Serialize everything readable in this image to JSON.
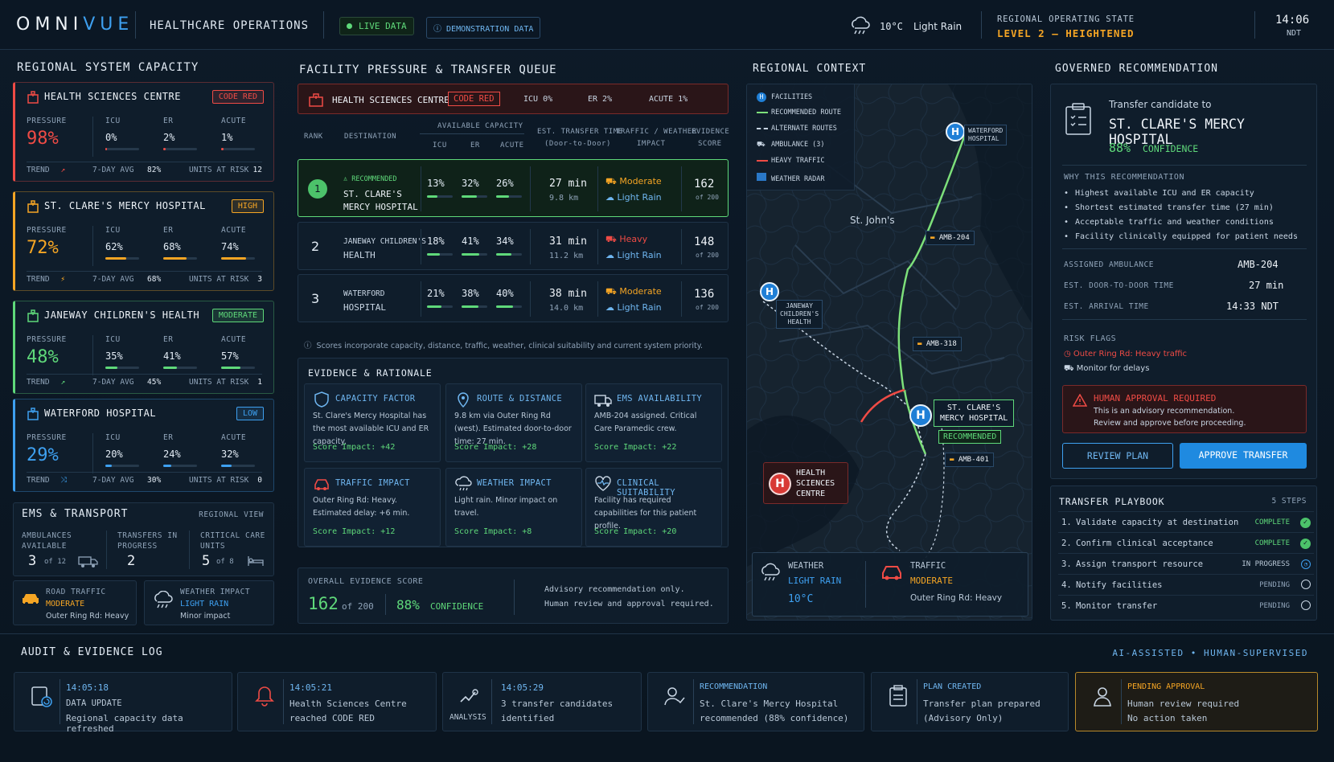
{
  "header": {
    "brand_a": "OMNI",
    "brand_b": "VUE",
    "section": "HEALTHCARE OPERATIONS",
    "live": "LIVE DATA",
    "demo": "DEMONSTRATION DATA",
    "temp": "10°C",
    "weather": "Light Rain",
    "state_label": "REGIONAL OPERATING STATE",
    "state_value": "LEVEL 2 – HEIGHTENED",
    "time": "14:06",
    "tz": "NDT"
  },
  "capacity": {
    "title": "REGIONAL SYSTEM CAPACITY",
    "labels": {
      "pressure": "PRESSURE",
      "icu": "ICU",
      "er": "ER",
      "acute": "ACUTE",
      "trend": "TREND",
      "avg": "7-DAY AVG",
      "units": "UNITS AT RISK"
    },
    "cards": [
      {
        "name": "HEALTH SCIENCES CENTRE",
        "badge": "CODE RED",
        "pressure": "98%",
        "icu": "0%",
        "er": "2%",
        "acute": "1%",
        "icu_v": 0.04,
        "er_v": 0.08,
        "acute_v": 0.06,
        "avg": "82%",
        "units": "12",
        "color": "#ef4b45"
      },
      {
        "name": "ST. CLARE'S MERCY HOSPITAL",
        "badge": "HIGH",
        "pressure": "72%",
        "icu": "62%",
        "er": "68%",
        "acute": "74%",
        "icu_v": 0.62,
        "er_v": 0.68,
        "acute_v": 0.74,
        "avg": "68%",
        "units": "3",
        "color": "#f5a524"
      },
      {
        "name": "JANEWAY CHILDREN'S HEALTH",
        "badge": "MODERATE",
        "pressure": "48%",
        "icu": "35%",
        "er": "41%",
        "acute": "57%",
        "icu_v": 0.35,
        "er_v": 0.41,
        "acute_v": 0.57,
        "avg": "45%",
        "units": "1",
        "color": "#5fd97a"
      },
      {
        "name": "WATERFORD HOSPITAL",
        "badge": "LOW",
        "pressure": "29%",
        "icu": "20%",
        "er": "24%",
        "acute": "32%",
        "icu_v": 0.2,
        "er_v": 0.24,
        "acute_v": 0.32,
        "avg": "30%",
        "units": "0",
        "color": "#3ea0f0"
      }
    ]
  },
  "ems": {
    "title": "EMS & TRANSPORT",
    "view": "REGIONAL VIEW",
    "amb_label": "AMBULANCES AVAILABLE",
    "amb": "3",
    "amb_of": "of 12",
    "trans_label": "TRANSFERS IN PROGRESS",
    "trans": "2",
    "crit_label": "CRITICAL CARE UNITS",
    "crit": "5",
    "crit_of": "of 8",
    "road_label": "ROAD TRAFFIC",
    "road_val": "MODERATE",
    "road_sub": "Outer Ring Rd: Heavy",
    "wx_label": "WEATHER IMPACT",
    "wx_val": "LIGHT RAIN",
    "wx_sub": "Minor impact"
  },
  "queue": {
    "title": "FACILITY PRESSURE & TRANSFER QUEUE",
    "src_name": "HEALTH SCIENCES CENTRE",
    "src_badge": "CODE RED",
    "src_icu": "ICU 0%",
    "src_er": "ER 2%",
    "src_acute": "ACUTE 1%",
    "cols": {
      "rank": "RANK",
      "dest": "DESTINATION",
      "avail": "AVAILABLE CAPACITY",
      "icu": "ICU",
      "er": "ER",
      "acute": "ACUTE",
      "time": "EST. TRANSFER TIME",
      "time2": "(Door-to-Door)",
      "tw": "TRAFFIC / WEATHER",
      "tw2": "IMPACT",
      "ev": "EVIDENCE",
      "ev2": "SCORE"
    },
    "rows": [
      {
        "rank": "1",
        "tag": "RECOMMENDED",
        "dest1": "ST. CLARE'S",
        "dest2": "MERCY HOSPITAL",
        "icu": "13%",
        "er": "32%",
        "acute": "26%",
        "icu_v": 0.4,
        "er_v": 0.6,
        "acute_v": 0.5,
        "time": "27 min",
        "dist": "9.8 km",
        "traffic": "Moderate",
        "wx": "Light Rain",
        "score": "162",
        "of": "of 200"
      },
      {
        "rank": "2",
        "tag": "",
        "dest1": "JANEWAY CHILDREN'S",
        "dest2": "HEALTH",
        "icu": "18%",
        "er": "41%",
        "acute": "34%",
        "icu_v": 0.5,
        "er_v": 0.7,
        "acute_v": 0.6,
        "time": "31 min",
        "dist": "11.2 km",
        "traffic": "Heavy",
        "wx": "Light Rain",
        "score": "148",
        "of": "of 200"
      },
      {
        "rank": "3",
        "tag": "",
        "dest1": "WATERFORD",
        "dest2": "HOSPITAL",
        "icu": "21%",
        "er": "38%",
        "acute": "40%",
        "icu_v": 0.55,
        "er_v": 0.65,
        "acute_v": 0.65,
        "time": "38 min",
        "dist": "14.0 km",
        "traffic": "Moderate",
        "wx": "Light Rain",
        "score": "136",
        "of": "of 200"
      }
    ],
    "note": "Scores incorporate capacity, distance, traffic, weather, clinical suitability and current system priority."
  },
  "evidence": {
    "title": "EVIDENCE & RATIONALE",
    "items": [
      {
        "t": "CAPACITY FACTOR",
        "d": "St. Clare's Mercy Hospital has the most available ICU and ER capacity.",
        "s": "Score Impact: +42"
      },
      {
        "t": "ROUTE & DISTANCE",
        "d": "9.8 km via Outer Ring Rd (west). Estimated door-to-door time: 27 min.",
        "s": "Score Impact: +28"
      },
      {
        "t": "EMS AVAILABILITY",
        "d": "AMB-204 assigned. Critical Care Paramedic crew.",
        "s": "Score Impact: +22"
      },
      {
        "t": "TRAFFIC IMPACT",
        "d": "Outer Ring Rd: Heavy. Estimated delay: +6 min.",
        "s": "Score Impact: +12"
      },
      {
        "t": "WEATHER IMPACT",
        "d": "Light rain. Minor impact on travel.",
        "s": "Score Impact: +8"
      },
      {
        "t": "CLINICAL SUITABILITY",
        "d": "Facility has required capabilities for this patient profile.",
        "s": "Score Impact: +20"
      }
    ],
    "overall_label": "OVERALL EVIDENCE SCORE",
    "overall": "162",
    "overall_of": "of 200",
    "conf": "88%",
    "conf_label": "CONFIDENCE",
    "adv1": "Advisory recommendation only.",
    "adv2": "Human review and approval required."
  },
  "map": {
    "title": "REGIONAL CONTEXT",
    "legend": [
      "FACILITIES",
      "RECOMMENDED ROUTE",
      "ALTERNATE ROUTES",
      "AMBULANCE (3)",
      "HEAVY TRAFFIC",
      "WEATHER RADAR"
    ],
    "city": "St. John's",
    "waterford": [
      "WATERFORD",
      "HOSPITAL"
    ],
    "janeway": [
      "JANEWAY",
      "CHILDREN'S",
      "HEALTH"
    ],
    "stclare": [
      "ST. CLARE'S",
      "MERCY HOSPITAL"
    ],
    "recommended": "RECOMMENDED",
    "hsc": [
      "HEALTH",
      "SCIENCES",
      "CENTRE"
    ],
    "amb1": "AMB-204",
    "amb2": "AMB-318",
    "amb3": "AMB-401",
    "h": "H",
    "wx_label": "WEATHER",
    "wx_val": "LIGHT RAIN",
    "wx_temp": "10°C",
    "tr_label": "TRAFFIC",
    "tr_val": "MODERATE",
    "tr_sub": "Outer Ring Rd: Heavy"
  },
  "rec": {
    "title": "GOVERNED RECOMMENDATION",
    "cand": "Transfer candidate to",
    "hosp": "ST. CLARE'S MERCY HOSPITAL",
    "conf": "88%",
    "conf_label": "CONFIDENCE",
    "why": "WHY THIS RECOMMENDATION",
    "reasons": [
      "Highest available ICU and ER capacity",
      "Shortest estimated transfer time (27 min)",
      "Acceptable traffic and weather conditions",
      "Facility clinically equipped for patient needs"
    ],
    "amb_label": "ASSIGNED AMBULANCE",
    "amb": "AMB-204",
    "d2d_label": "EST. DOOR-TO-DOOR TIME",
    "d2d": "27 min",
    "arr_label": "EST. ARRIVAL TIME",
    "arr": "14:33 NDT",
    "risk": "RISK FLAGS",
    "risk1": "Outer Ring Rd: Heavy traffic",
    "risk2": "Monitor for delays",
    "hap": "HUMAN APPROVAL REQUIRED",
    "hap1": "This is an advisory recommendation.",
    "hap2": "Review and approve before proceeding.",
    "review": "REVIEW PLAN",
    "approve": "APPROVE TRANSFER"
  },
  "playbook": {
    "title": "TRANSFER PLAYBOOK",
    "steps_count": "5 STEPS",
    "steps": [
      {
        "n": "1.",
        "t": "Validate capacity at destination",
        "s": "COMPLETE"
      },
      {
        "n": "2.",
        "t": "Confirm clinical acceptance",
        "s": "COMPLETE"
      },
      {
        "n": "3.",
        "t": "Assign transport resource",
        "s": "IN PROGRESS"
      },
      {
        "n": "4.",
        "t": "Notify facilities",
        "s": "PENDING"
      },
      {
        "n": "5.",
        "t": "Monitor transfer",
        "s": "PENDING"
      }
    ]
  },
  "audit": {
    "title": "AUDIT & EVIDENCE LOG",
    "tag": "AI-ASSISTED • HUMAN-SUPERVISED",
    "items": [
      {
        "a": "14:05:18",
        "b": "DATA UPDATE",
        "c": "Regional capacity data refreshed"
      },
      {
        "a": "14:05:21",
        "b": "Health Sciences Centre",
        "c": "reached CODE RED"
      },
      {
        "a": "14:05:29",
        "b": "3 transfer candidates",
        "c": "identified",
        "x": "ANALYSIS"
      },
      {
        "a": "RECOMMENDATION",
        "b": "St. Clare's Mercy Hospital",
        "c": "recommended (88% confidence)"
      },
      {
        "a": "PLAN CREATED",
        "b": "Transfer plan prepared",
        "c": "(Advisory Only)"
      },
      {
        "a": "PENDING APPROVAL",
        "b": "Human review required",
        "c": "No action taken"
      }
    ]
  }
}
